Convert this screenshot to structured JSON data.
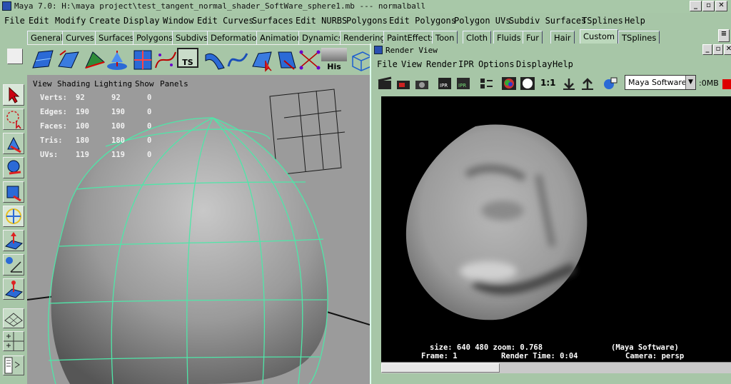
{
  "titlebar": {
    "title": "Maya 7.0: H:\\maya project\\test_tangent_normal_shader_SoftWare_sphere1.mb  ---   normalball",
    "min": "_",
    "max": "▫",
    "close": "✕"
  },
  "menubar": [
    "File",
    "Edit",
    "Modify",
    "Create",
    "Display",
    "Window",
    "Edit Curves",
    "Surfaces",
    "Edit NURBS",
    "Polygons",
    "Edit Polygons",
    "Polygon UVs",
    "Subdiv Surfaces",
    "TSplines",
    "Help"
  ],
  "shelf_tabs": [
    "General",
    "Curves",
    "Surfaces",
    "Polygons",
    "Subdivs",
    "Deformation",
    "Animation",
    "Dynamics",
    "Rendering",
    "PaintEffects",
    "Toon",
    "Cloth",
    "Fluids",
    "Fur",
    "Hair",
    "Custom",
    "TSplines"
  ],
  "shelf_active": "Custom",
  "shelf_labels": {
    "ts": "TS",
    "his": "His"
  },
  "viewport": {
    "menu": [
      "View",
      "Shading",
      "Lighting",
      "Show",
      "Panels"
    ],
    "hud": {
      "labels": [
        "Verts:",
        "Edges:",
        "Faces:",
        "Tris:",
        "UVs:"
      ],
      "col1": [
        "92",
        "190",
        "100",
        "180",
        "119"
      ],
      "col2": [
        "92",
        "190",
        "100",
        "180",
        "119"
      ],
      "col3": [
        "0",
        "0",
        "0",
        "0",
        "0"
      ]
    }
  },
  "render_view": {
    "title": "Render View",
    "menu": [
      "File",
      "View",
      "Render",
      "IPR",
      "Options",
      "Display",
      "Help"
    ],
    "ratio": "1:1",
    "renderer": "Maya Software",
    "omb": ":0MB",
    "info": {
      "size": "size:  640  480 zoom: 0.768",
      "renderer": "(Maya Software)",
      "frame": "Frame: 1",
      "time": "Render Time: 0:04",
      "camera": "Camera: persp"
    }
  },
  "colors": {
    "ui_green": "#a7c6a7",
    "wire": "#4fe6a8",
    "render_bg": "#000000"
  }
}
